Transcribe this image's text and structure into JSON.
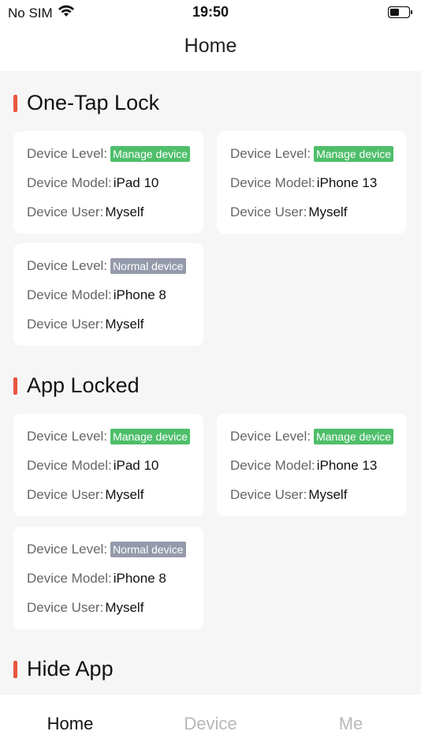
{
  "status": {
    "carrier": "No SIM",
    "time": "19:50",
    "icons": [
      "wifi-icon",
      "battery-icon"
    ]
  },
  "nav": {
    "title": "Home"
  },
  "labels": {
    "level": "Device Level:",
    "model": "Device Model:",
    "user": "Device User:"
  },
  "sections": [
    {
      "title": "One-Tap Lock",
      "cards": [
        {
          "level": "Manage device",
          "level_type": "manage",
          "model": "iPad 10",
          "user": "Myself"
        },
        {
          "level": "Manage device",
          "level_type": "manage",
          "model": "iPhone 13",
          "user": "Myself"
        },
        {
          "level": "Normal device",
          "level_type": "normal",
          "model": "iPhone 8",
          "user": "Myself"
        }
      ]
    },
    {
      "title": "App Locked",
      "cards": [
        {
          "level": "Manage device",
          "level_type": "manage",
          "model": "iPad 10",
          "user": "Myself"
        },
        {
          "level": "Manage device",
          "level_type": "manage",
          "model": "iPhone 13",
          "user": "Myself"
        },
        {
          "level": "Normal device",
          "level_type": "normal",
          "model": "iPhone 8",
          "user": "Myself"
        }
      ]
    },
    {
      "title": "Hide App",
      "cards": []
    }
  ],
  "tabs": [
    {
      "label": "Home",
      "active": true
    },
    {
      "label": "Device",
      "active": false
    },
    {
      "label": "Me",
      "active": false
    }
  ],
  "colors": {
    "accent_bar": "#e8553d",
    "manage_badge": "#4ebe6a",
    "normal_badge": "#959aab",
    "tab_inactive": "#b8b8b8"
  }
}
